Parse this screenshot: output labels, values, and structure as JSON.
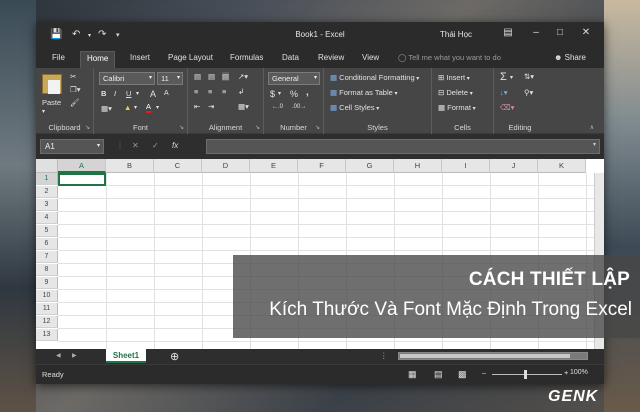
{
  "window": {
    "title": "Book1 - Excel",
    "user": "Thái Học"
  },
  "tabs": [
    "File",
    "Home",
    "Insert",
    "Page Layout",
    "Formulas",
    "Data",
    "Review",
    "View"
  ],
  "tell_me": "Tell me what you want to do",
  "share": "Share",
  "ribbon": {
    "clipboard": {
      "paste": "Paste",
      "label": "Clipboard"
    },
    "font": {
      "name": "Calibri",
      "size": "11",
      "bold": "B",
      "italic": "I",
      "underline": "U",
      "grow": "A",
      "shrink": "A",
      "color_letter": "A",
      "label": "Font"
    },
    "alignment": {
      "label": "Alignment"
    },
    "number": {
      "format": "General",
      "currency": "$",
      "percent": "%",
      "comma": ",",
      "label": "Number"
    },
    "styles": {
      "conditional": "Conditional Formatting",
      "table": "Format as Table",
      "cell": "Cell Styles",
      "label": "Styles"
    },
    "cells": {
      "insert": "Insert",
      "delete": "Delete",
      "format": "Format",
      "label": "Cells"
    },
    "editing": {
      "label": "Editing"
    }
  },
  "formula_bar": {
    "name_box": "A1",
    "fx": "fx"
  },
  "columns": [
    "A",
    "B",
    "C",
    "D",
    "E",
    "F",
    "G",
    "H",
    "I",
    "J",
    "K"
  ],
  "rows": [
    "1",
    "2",
    "3",
    "4",
    "5",
    "6",
    "7",
    "8",
    "9",
    "10",
    "11",
    "12",
    "13"
  ],
  "sheet_tab": "Sheet1",
  "status": {
    "ready": "Ready",
    "zoom": "100%"
  },
  "overlay": {
    "line1": "CÁCH THIẾT LẬP",
    "line2": "Kích Thước Và Font Mặc Định Trong Excel"
  },
  "watermark": "GENK",
  "colors": {
    "accent": "#217346",
    "ribbon": "#464646",
    "titlebar": "#2b2b2b"
  }
}
